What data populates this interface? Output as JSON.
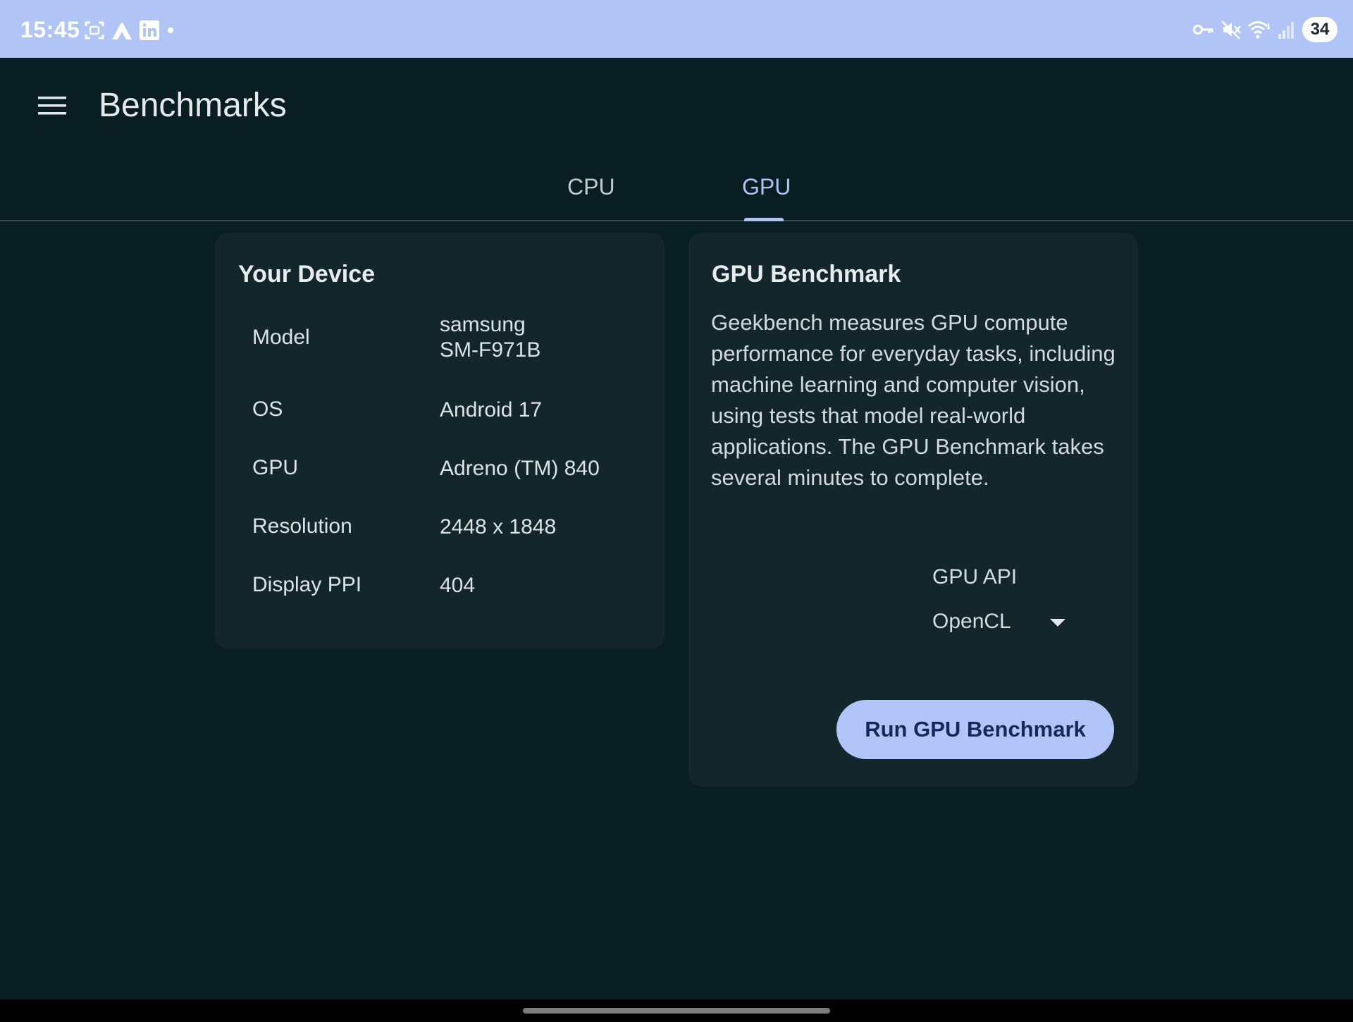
{
  "status_bar": {
    "time": "15:45",
    "battery_level": "34",
    "left_icons": [
      "screenshot-icon",
      "nordvpn-icon",
      "linkedin-icon",
      "dot-icon"
    ],
    "right_icons": [
      "vpn-key-icon",
      "mute-icon",
      "wifi-icon",
      "signal-icon"
    ]
  },
  "app_bar": {
    "title": "Benchmarks",
    "menu_icon": "hamburger-menu-icon"
  },
  "tabs": [
    {
      "label": "CPU",
      "selected": false
    },
    {
      "label": "GPU",
      "selected": true
    }
  ],
  "device_card": {
    "title": "Your Device",
    "specs": [
      {
        "label": "Model",
        "value": "samsung\nSM-F971B"
      },
      {
        "label": "OS",
        "value": "Android 17"
      },
      {
        "label": "GPU",
        "value": "Adreno (TM) 840"
      },
      {
        "label": "Resolution",
        "value": "2448 x 1848"
      },
      {
        "label": "Display PPI",
        "value": "404"
      }
    ]
  },
  "gpu_card": {
    "title": "GPU Benchmark",
    "description": "Geekbench measures GPU compute performance for everyday tasks, including machine learning and computer vision, using tests that model real-world applications. The GPU Benchmark takes several minutes to complete.",
    "api_label": "GPU API",
    "api_selected": "OpenCL",
    "run_button_label": "Run GPU Benchmark"
  },
  "colors": {
    "background": "#091e22",
    "card": "#13262b",
    "accent": "#b0c4f4",
    "status_bar": "#b1c4f6"
  }
}
